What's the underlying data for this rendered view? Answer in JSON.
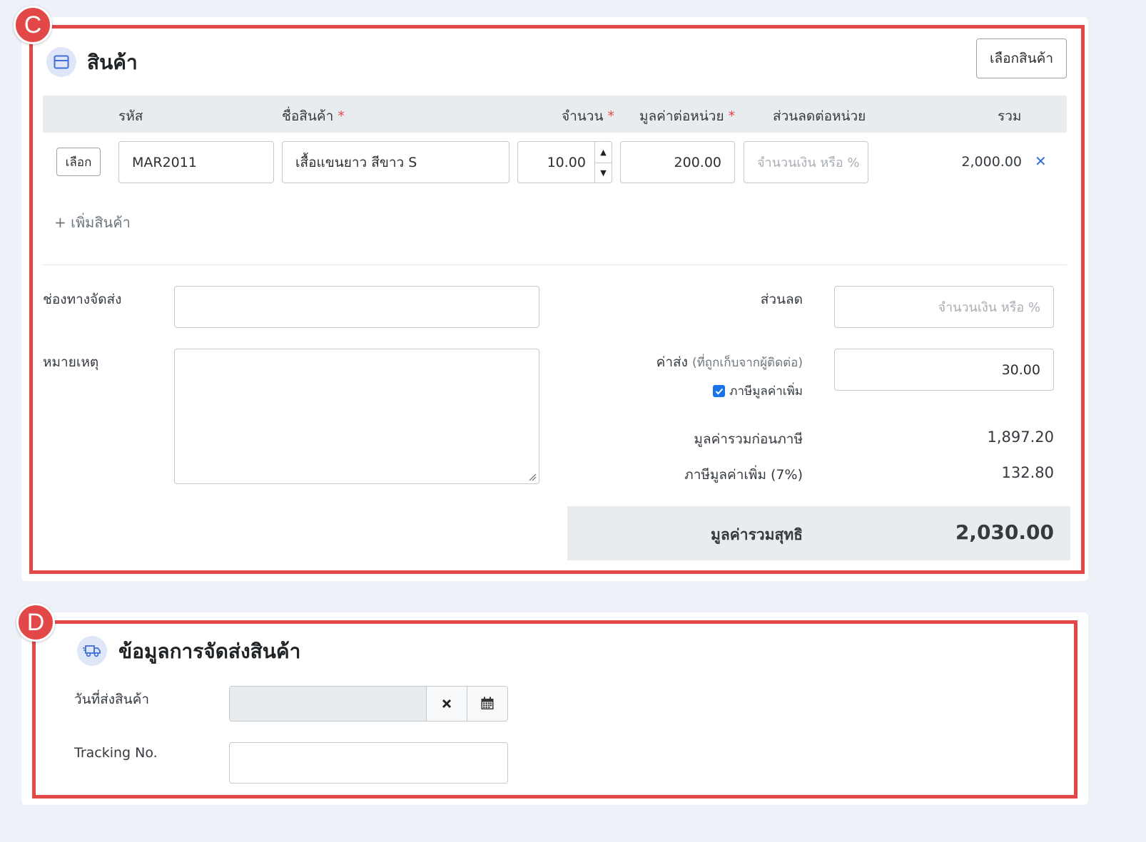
{
  "products": {
    "marker": "C",
    "title": "สินค้า",
    "icon": "box-icon",
    "select_products_button": "เลือกสินค้า",
    "columns": {
      "code": "รหัส",
      "name": "ชื่อสินค้า",
      "qty": "จำนวน",
      "unit_price": "มูลค่าต่อหน่วย",
      "unit_discount": "ส่วนลดต่อหน่วย",
      "total": "รวม",
      "required_mark": "*"
    },
    "rows": [
      {
        "select_label": "เลือก",
        "code": "MAR2011",
        "name": "เสื้อแขนยาว สีขาว S",
        "qty": "10.00",
        "unit_price": "200.00",
        "unit_discount_placeholder": "จำนวนเงิน หรือ %",
        "total": "2,000.00",
        "remove": "✕"
      }
    ],
    "add_item": "+ เพิ่มสินค้า",
    "shipping_channel_label": "ช่องทางจัดส่ง",
    "note_label": "หมายเหตุ",
    "discount_label": "ส่วนลด",
    "discount_placeholder": "จำนวนเงิน หรือ %",
    "shipping_fee_label": "ค่าส่ง",
    "shipping_fee_hint": "(ที่ถูกเก็บจากผู้ติดต่อ)",
    "shipping_fee_value": "30.00",
    "vat_checkbox_label": "ภาษีมูลค่าเพิ่ม",
    "vat_checked": true,
    "subtotal_label": "มูลค่ารวมก่อนภาษี",
    "subtotal_value": "1,897.20",
    "vat_label": "ภาษีมูลค่าเพิ่ม (7%)",
    "vat_value": "132.80",
    "grand_total_label": "มูลค่ารวมสุทธิ",
    "grand_total_value": "2,030.00"
  },
  "shipping": {
    "marker": "D",
    "title": "ข้อมูลการจัดส่งสินค้า",
    "icon": "truck-icon",
    "ship_date_label": "วันที่ส่งสินค้า",
    "ship_date_value": "",
    "tracking_label": "Tracking No.",
    "tracking_value": ""
  },
  "colors": {
    "highlight": "#e24848",
    "remove_icon": "#2f6fd6",
    "page_bg": "#eef1f8"
  }
}
